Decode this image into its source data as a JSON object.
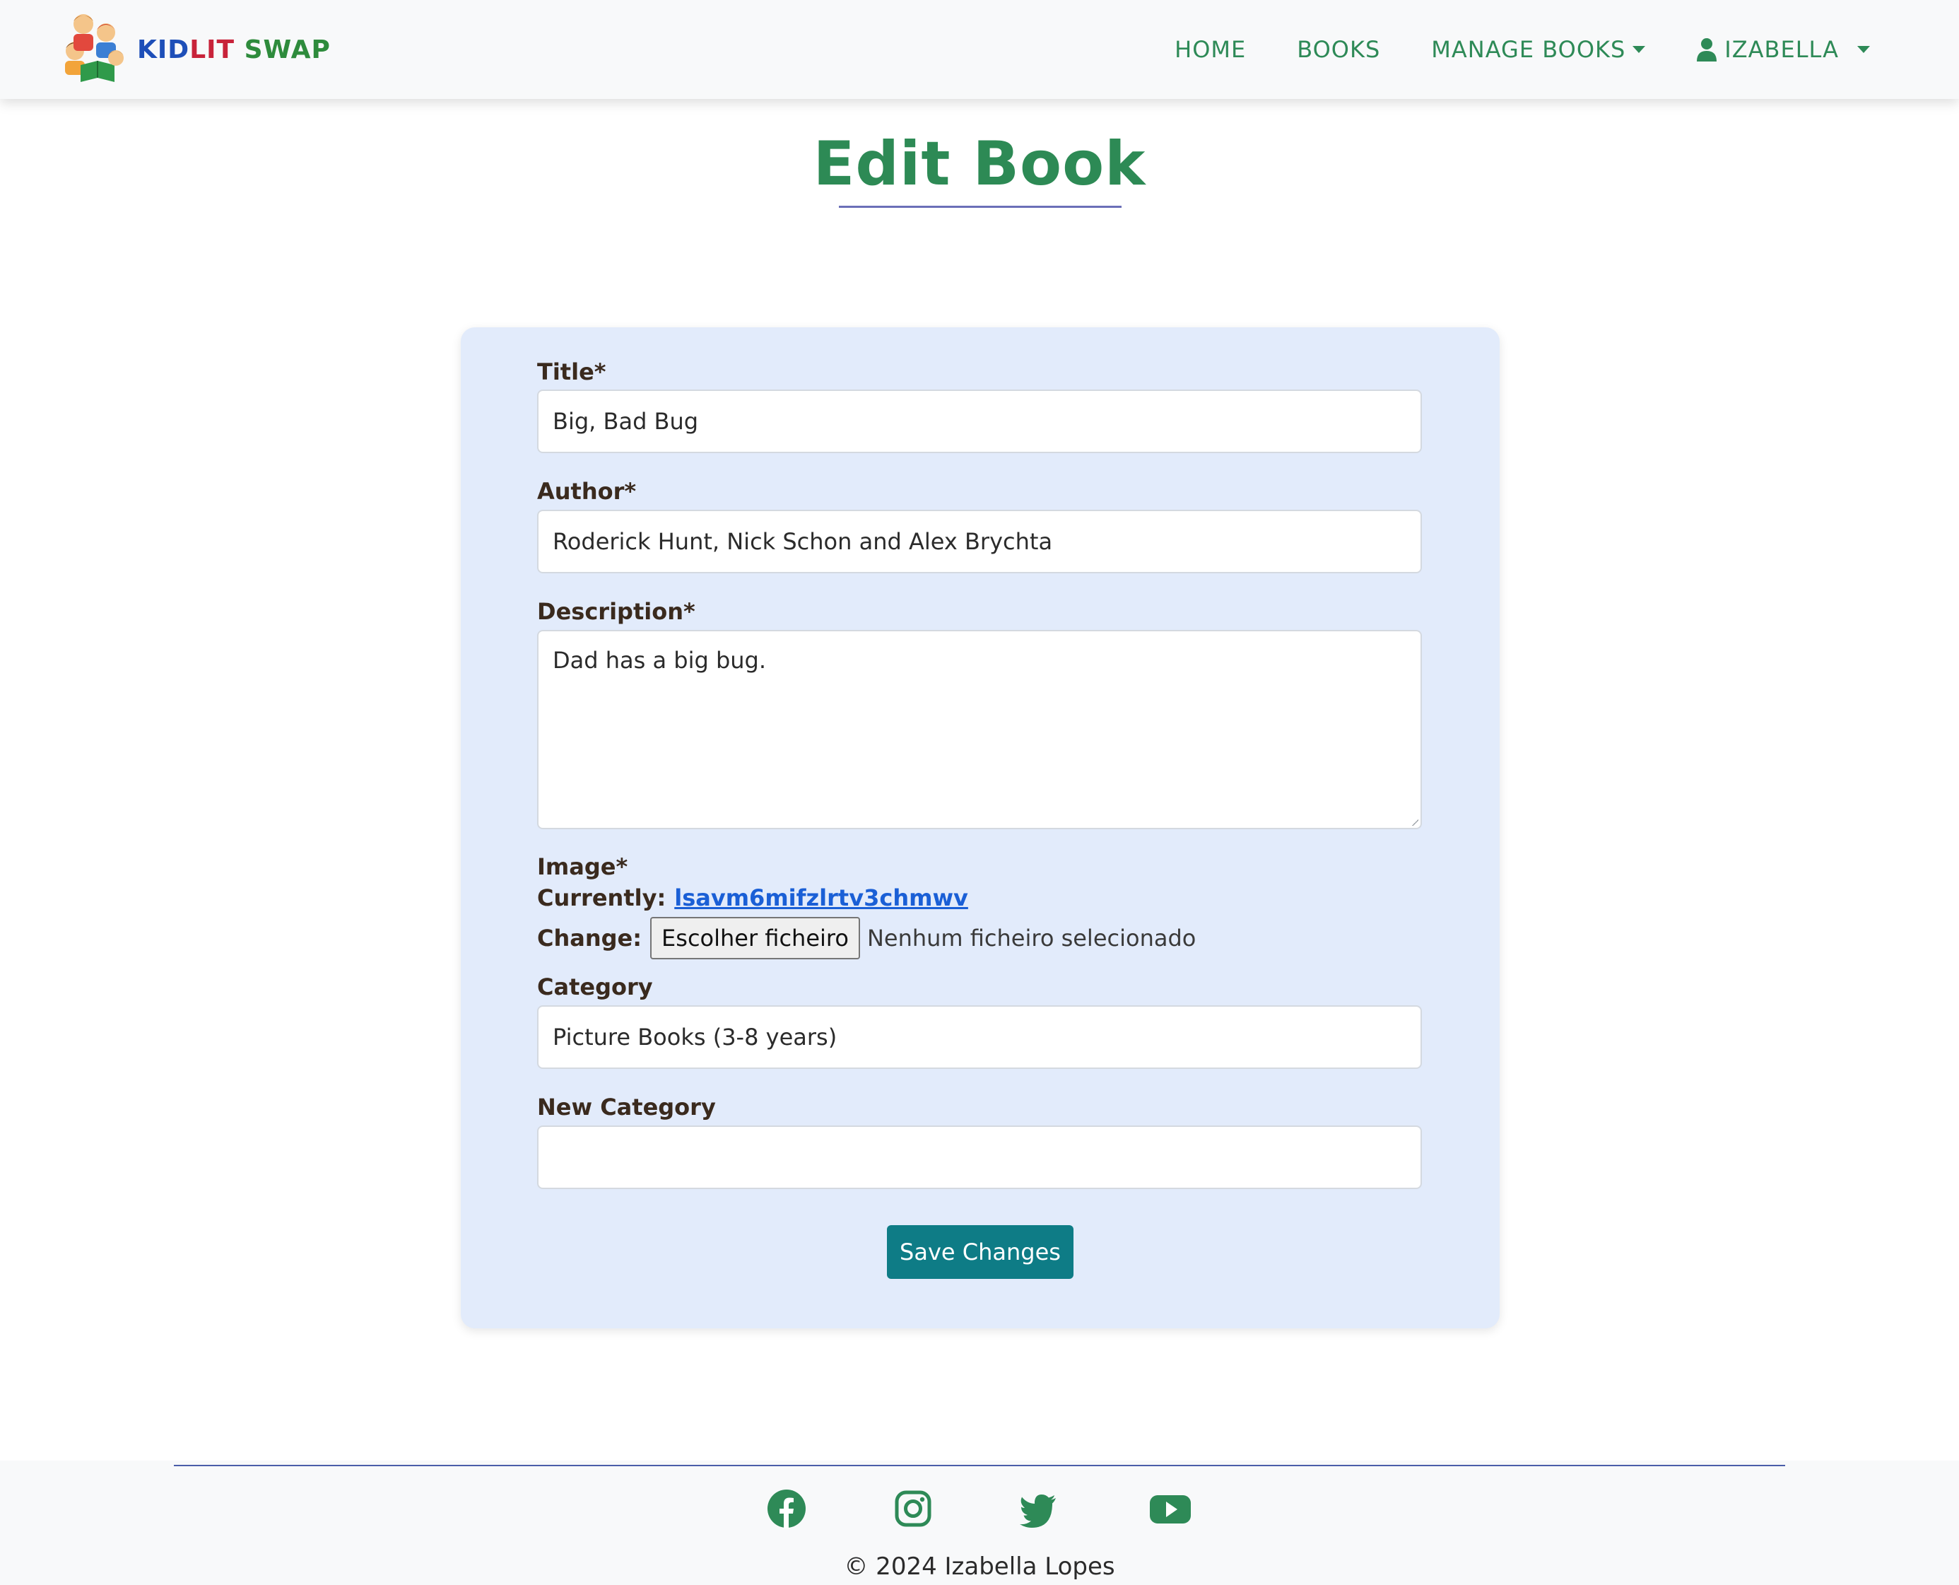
{
  "nav": {
    "brand": {
      "kid": "KID",
      "lit": "LIT",
      "swap": "SWAP"
    },
    "links": {
      "home": "HOME",
      "books": "BOOKS",
      "manage_books": "MANAGE BOOKS",
      "user": "IZABELLA"
    }
  },
  "page": {
    "title": "Edit Book"
  },
  "form": {
    "title": {
      "label": "Title*",
      "value": "Big, Bad Bug"
    },
    "author": {
      "label": "Author*",
      "value": "Roderick Hunt, Nick Schon and Alex Brychta"
    },
    "description": {
      "label": "Description*",
      "value": "Dad has a big bug."
    },
    "image": {
      "label": "Image*",
      "currently_label": "Currently:",
      "current_file": "lsavm6mifzlrtv3chmwv",
      "change_label": "Change:",
      "choose_button": "Escolher ficheiro",
      "no_file": "Nenhum ficheiro selecionado"
    },
    "category": {
      "label": "Category",
      "value": "Picture Books (3-8 years)"
    },
    "new_category": {
      "label": "New Category",
      "value": ""
    },
    "submit": "Save Changes"
  },
  "footer": {
    "social": [
      "facebook-icon",
      "instagram-icon",
      "twitter-icon",
      "youtube-icon"
    ],
    "copyright": "© 2024 Izabella Lopes"
  },
  "colors": {
    "accent_green": "#2e8a57",
    "card_bg": "#e2ebfb",
    "button_teal": "#0e7c86",
    "link_blue": "#1a5fd6"
  }
}
